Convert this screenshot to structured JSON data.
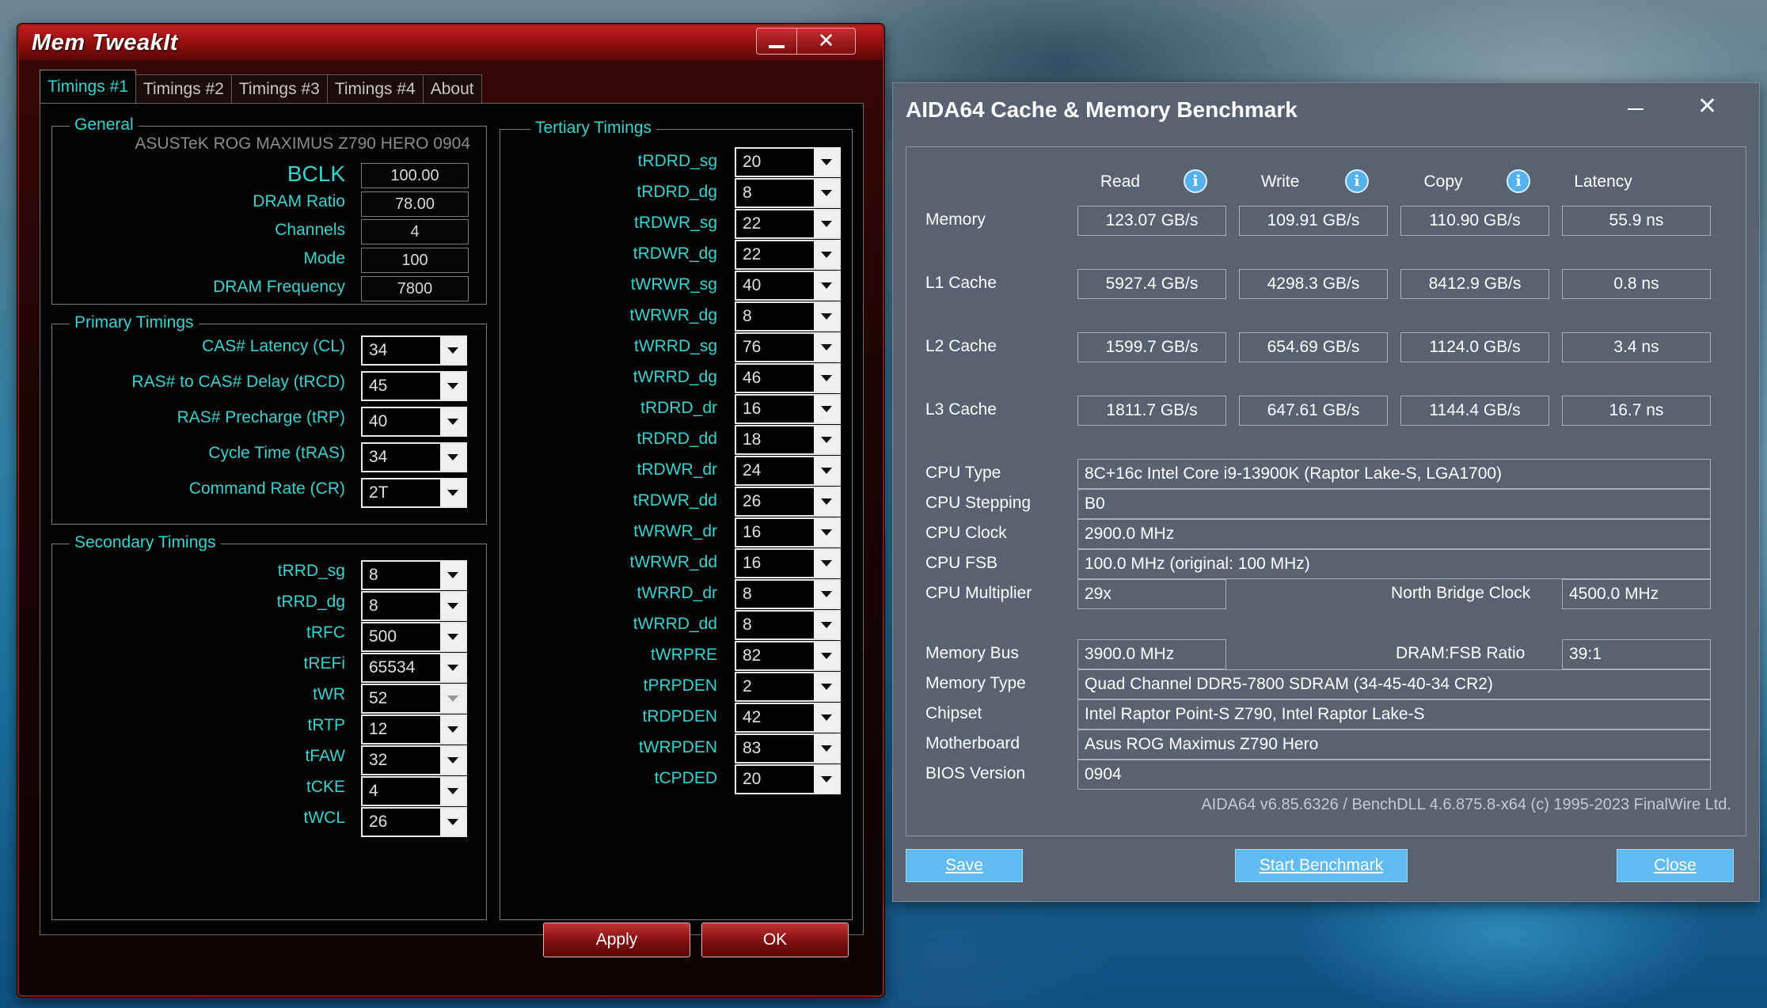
{
  "memtweakit": {
    "title": "Mem TweakIt",
    "tabs": [
      "Timings #1",
      "Timings #2",
      "Timings #3",
      "Timings #4",
      "About"
    ],
    "general": {
      "title": "General",
      "board": "ASUSTeK ROG MAXIMUS Z790 HERO 0904",
      "bclk_label": "BCLK",
      "bclk": "100.00",
      "dram_ratio_label": "DRAM Ratio",
      "dram_ratio": "78.00",
      "channels_label": "Channels",
      "channels": "4",
      "mode_label": "Mode",
      "mode": "100",
      "dram_freq_label": "DRAM Frequency",
      "dram_freq": "7800"
    },
    "primary": {
      "title": "Primary Timings",
      "items": [
        {
          "label": "CAS# Latency (CL)",
          "value": "34"
        },
        {
          "label": "RAS# to CAS# Delay (tRCD)",
          "value": "45"
        },
        {
          "label": "RAS# Precharge (tRP)",
          "value": "40"
        },
        {
          "label": "Cycle Time (tRAS)",
          "value": "34"
        },
        {
          "label": "Command Rate (CR)",
          "value": "2T"
        }
      ]
    },
    "secondary": {
      "title": "Secondary Timings",
      "items": [
        {
          "label": "tRRD_sg",
          "value": "8"
        },
        {
          "label": "tRRD_dg",
          "value": "8"
        },
        {
          "label": "tRFC",
          "value": "500"
        },
        {
          "label": "tREFi",
          "value": "65534"
        },
        {
          "label": "tWR",
          "value": "52"
        },
        {
          "label": "tRTP",
          "value": "12"
        },
        {
          "label": "tFAW",
          "value": "32"
        },
        {
          "label": "tCKE",
          "value": "4"
        },
        {
          "label": "tWCL",
          "value": "26"
        }
      ]
    },
    "tertiary": {
      "title": "Tertiary Timings",
      "items": [
        {
          "label": "tRDRD_sg",
          "value": "20"
        },
        {
          "label": "tRDRD_dg",
          "value": "8"
        },
        {
          "label": "tRDWR_sg",
          "value": "22"
        },
        {
          "label": "tRDWR_dg",
          "value": "22"
        },
        {
          "label": "tWRWR_sg",
          "value": "40"
        },
        {
          "label": "tWRWR_dg",
          "value": "8"
        },
        {
          "label": "tWRRD_sg",
          "value": "76"
        },
        {
          "label": "tWRRD_dg",
          "value": "46"
        },
        {
          "label": "tRDRD_dr",
          "value": "16"
        },
        {
          "label": "tRDRD_dd",
          "value": "18"
        },
        {
          "label": "tRDWR_dr",
          "value": "24"
        },
        {
          "label": "tRDWR_dd",
          "value": "26"
        },
        {
          "label": "tWRWR_dr",
          "value": "16"
        },
        {
          "label": "tWRWR_dd",
          "value": "16"
        },
        {
          "label": "tWRRD_dr",
          "value": "8"
        },
        {
          "label": "tWRRD_dd",
          "value": "8"
        },
        {
          "label": "tWRPRE",
          "value": "82"
        },
        {
          "label": "tPRPDEN",
          "value": "2"
        },
        {
          "label": "tRDPDEN",
          "value": "42"
        },
        {
          "label": "tWRPDEN",
          "value": "83"
        },
        {
          "label": "tCPDED",
          "value": "20"
        }
      ]
    },
    "buttons": {
      "apply": "Apply",
      "ok": "OK"
    }
  },
  "aida": {
    "title": "AIDA64 Cache & Memory Benchmark",
    "columns": {
      "read": "Read",
      "write": "Write",
      "copy": "Copy",
      "latency": "Latency"
    },
    "rows": [
      {
        "label": "Memory",
        "read": "123.07 GB/s",
        "write": "109.91 GB/s",
        "copy": "110.90 GB/s",
        "latency": "55.9 ns"
      },
      {
        "label": "L1 Cache",
        "read": "5927.4 GB/s",
        "write": "4298.3 GB/s",
        "copy": "8412.9 GB/s",
        "latency": "0.8 ns"
      },
      {
        "label": "L2 Cache",
        "read": "1599.7 GB/s",
        "write": "654.69 GB/s",
        "copy": "1124.0 GB/s",
        "latency": "3.4 ns"
      },
      {
        "label": "L3 Cache",
        "read": "1811.7 GB/s",
        "write": "647.61 GB/s",
        "copy": "1144.4 GB/s",
        "latency": "16.7 ns"
      }
    ],
    "cpu": {
      "type_label": "CPU Type",
      "type": "8C+16c Intel Core i9-13900K  (Raptor Lake-S, LGA1700)",
      "stepping_label": "CPU Stepping",
      "stepping": "B0",
      "clock_label": "CPU Clock",
      "clock": "2900.0 MHz",
      "fsb_label": "CPU FSB",
      "fsb": "100.0 MHz  (original: 100 MHz)",
      "mult_label": "CPU Multiplier",
      "mult": "29x",
      "nb_label": "North Bridge Clock",
      "nb": "4500.0 MHz"
    },
    "mem": {
      "bus_label": "Memory Bus",
      "bus": "3900.0 MHz",
      "ratio_label": "DRAM:FSB Ratio",
      "ratio": "39:1",
      "type_label": "Memory Type",
      "type": "Quad Channel DDR5-7800 SDRAM  (34-45-40-34 CR2)",
      "chipset_label": "Chipset",
      "chipset": "Intel Raptor Point-S Z790, Intel Raptor Lake-S",
      "mobo_label": "Motherboard",
      "mobo": "Asus ROG Maximus Z790 Hero",
      "bios_label": "BIOS Version",
      "bios": "0904"
    },
    "footer": "AIDA64 v6.85.6326 / BenchDLL 4.6.875.8-x64  (c) 1995-2023 FinalWire Ltd.",
    "buttons": {
      "save": "Save",
      "start": "Start Benchmark",
      "close": "Close"
    }
  },
  "icons": {
    "info": "info-icon",
    "minimize": "minimize-icon",
    "close": "close-icon",
    "dropdown": "chevron-down-icon"
  },
  "colors": {
    "mt_accent": "#37d3d0",
    "mt_red": "#a01515",
    "aida_bg": "#586270",
    "aida_button": "#60bbf0"
  }
}
